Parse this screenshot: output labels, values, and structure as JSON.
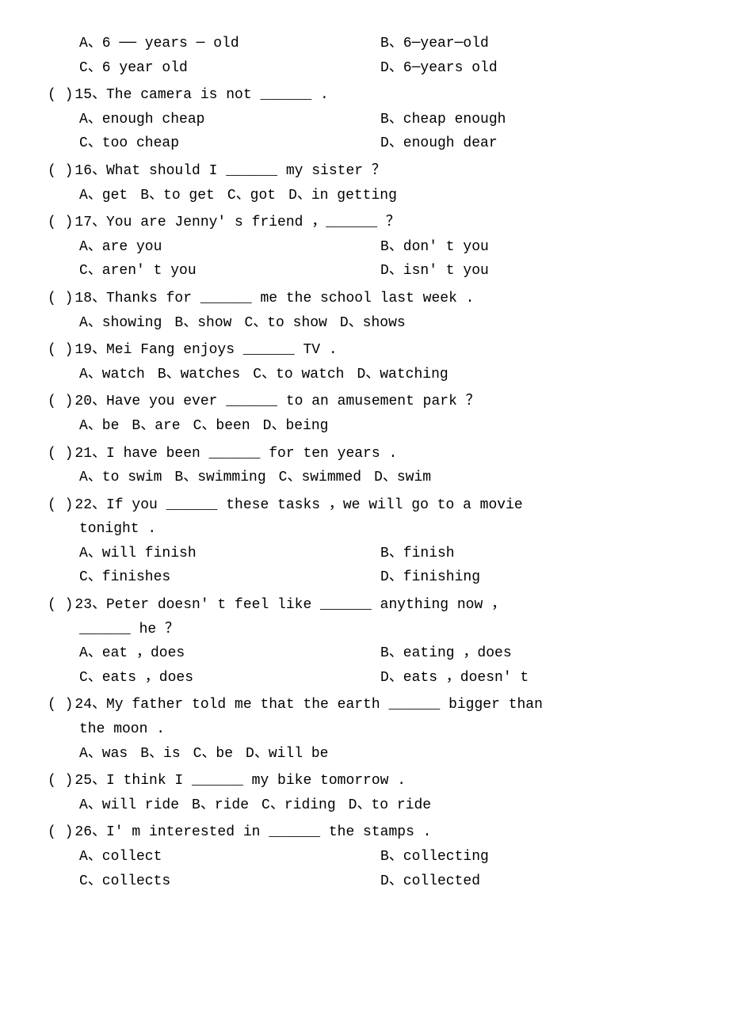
{
  "questions": [
    {
      "id": "q14_a",
      "line": "A、6 ── years ─ old",
      "col2": "B、6─year─old"
    },
    {
      "id": "q14_b",
      "line": "C、6 year old",
      "col2": "D、6─years old"
    },
    {
      "id": "q15",
      "paren": "( )",
      "num": "15、",
      "text": "The camera is not ______ .",
      "options": [
        {
          "label": "A、enough cheap",
          "col": 1
        },
        {
          "label": "B、cheap enough",
          "col": 2
        },
        {
          "label": "C、too cheap",
          "col": 1
        },
        {
          "label": "D、enough dear",
          "col": 2
        }
      ]
    },
    {
      "id": "q16",
      "paren": "( )",
      "num": "16、",
      "text": "What should I ______ my sister ？",
      "options4": [
        "A、get",
        "B、to get",
        "C、got",
        "D、in getting"
      ]
    },
    {
      "id": "q17",
      "paren": "( )",
      "num": "17、",
      "text": "You are Jenny' s friend ，______ ？",
      "options": [
        {
          "label": "A、are you",
          "col": 1
        },
        {
          "label": "B、don' t you",
          "col": 2
        },
        {
          "label": "C、aren' t you",
          "col": 1
        },
        {
          "label": "D、isn' t you",
          "col": 2
        }
      ]
    },
    {
      "id": "q18",
      "paren": "( )",
      "num": "18、",
      "text": "Thanks for ______ me the school last week .",
      "options4": [
        "A、showing",
        "B、show",
        "C、to show",
        "D、shows"
      ]
    },
    {
      "id": "q19",
      "paren": "( )",
      "num": "19、",
      "text": "Mei Fang enjoys ______ TV .",
      "options4": [
        "A、watch",
        "B、watches",
        "C、to watch",
        "D、watching"
      ]
    },
    {
      "id": "q20",
      "paren": "( )",
      "num": "20、",
      "text": "Have you ever ______ to an amusement park ？",
      "options4": [
        "A、be",
        "B、are",
        "C、been",
        "D、being"
      ]
    },
    {
      "id": "q21",
      "paren": "( )",
      "num": "21、",
      "text": "I have been ______ for ten years .",
      "options4": [
        "A、to swim",
        "B、swimming",
        "C、swimmed",
        "D、swim"
      ]
    },
    {
      "id": "q22",
      "paren": "( )",
      "num": "22、",
      "text": "If you ______ these tasks ，we will go to a movie",
      "continuation": "tonight .",
      "options": [
        {
          "label": "A、will finish",
          "col": 1
        },
        {
          "label": "B、finish",
          "col": 2
        },
        {
          "label": "C、finishes",
          "col": 1
        },
        {
          "label": "D、finishing",
          "col": 2
        }
      ]
    },
    {
      "id": "q23",
      "paren": "( )",
      "num": "23、",
      "text": "Peter doesn' t feel like ______ anything now ，",
      "continuation": "______ he ？",
      "options": [
        {
          "label": "A、eat ，does",
          "col": 1
        },
        {
          "label": "B、eating ，does",
          "col": 2
        },
        {
          "label": "C、eats ，does",
          "col": 1
        },
        {
          "label": "D、eats ，doesn' t",
          "col": 2
        }
      ]
    },
    {
      "id": "q24",
      "paren": "( )",
      "num": "24、",
      "text": "My father told me that the earth ______ bigger than",
      "continuation": "the moon .",
      "options4": [
        "A、was",
        "B、is",
        "C、be",
        "D、will be"
      ]
    },
    {
      "id": "q25",
      "paren": "( )",
      "num": "25、",
      "text": "I think I ______ my bike tomorrow .",
      "options4": [
        "A、will ride",
        "B、ride",
        "C、riding",
        "D、to ride"
      ]
    },
    {
      "id": "q26",
      "paren": "( )",
      "num": "26、",
      "text": "I' m interested in ______ the stamps .",
      "options": [
        {
          "label": "A、collect",
          "col": 1
        },
        {
          "label": "B、collecting",
          "col": 2
        },
        {
          "label": "C、collects",
          "col": 1
        },
        {
          "label": "D、collected",
          "col": 2
        }
      ]
    }
  ]
}
